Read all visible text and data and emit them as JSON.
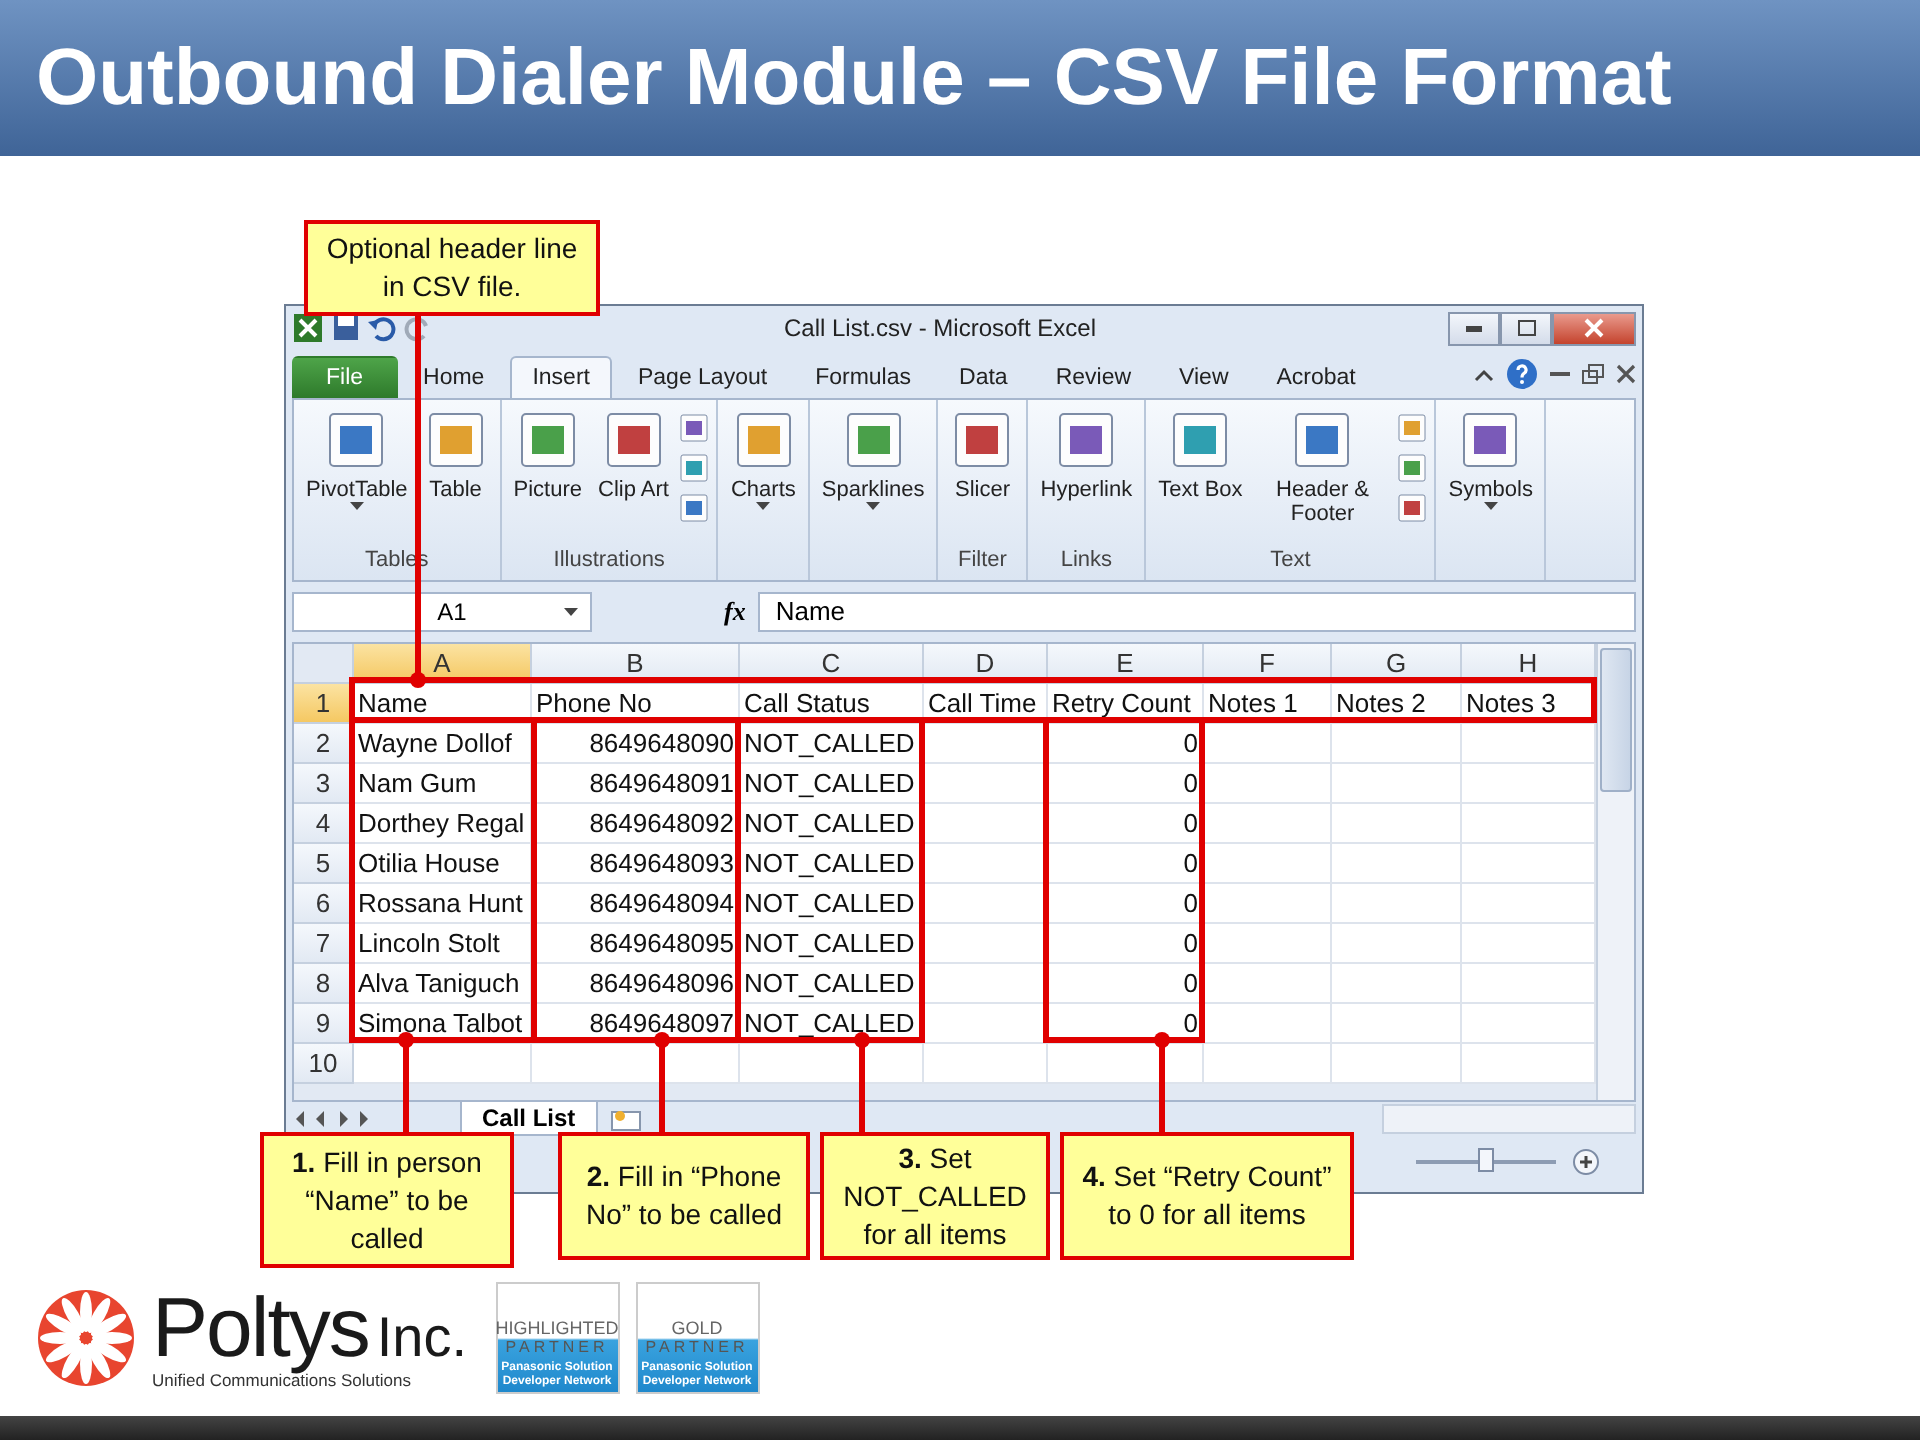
{
  "slide_title": "Outbound Dialer Module – CSV File Format",
  "excel": {
    "window_title": "Call List.csv  -  Microsoft Excel",
    "tabs": [
      {
        "label": "File",
        "kind": "file",
        "selected": false
      },
      {
        "label": "Home",
        "kind": "tab",
        "selected": false
      },
      {
        "label": "Insert",
        "kind": "tab",
        "selected": true
      },
      {
        "label": "Page Layout",
        "kind": "tab",
        "selected": false
      },
      {
        "label": "Formulas",
        "kind": "tab",
        "selected": false
      },
      {
        "label": "Data",
        "kind": "tab",
        "selected": false
      },
      {
        "label": "Review",
        "kind": "tab",
        "selected": false
      },
      {
        "label": "View",
        "kind": "tab",
        "selected": false
      },
      {
        "label": "Acrobat",
        "kind": "tab",
        "selected": false
      }
    ],
    "ribbon_groups": [
      {
        "label": "Tables",
        "kind": "plain",
        "buttons": [
          {
            "label": "PivotTable",
            "dropdown": true
          },
          {
            "label": "Table",
            "dropdown": false
          }
        ]
      },
      {
        "label": "Illustrations",
        "kind": "stacked",
        "buttons": [
          {
            "label": "Picture",
            "dropdown": false
          },
          {
            "label": "Clip Art",
            "dropdown": false
          }
        ]
      },
      {
        "kind": "plain",
        "buttons": [
          {
            "label": "Charts",
            "dropdown": true
          }
        ]
      },
      {
        "kind": "plain",
        "buttons": [
          {
            "label": "Sparklines",
            "dropdown": true
          }
        ]
      },
      {
        "label": "Filter",
        "kind": "plain",
        "buttons": [
          {
            "label": "Slicer",
            "dropdown": false
          }
        ]
      },
      {
        "label": "Links",
        "kind": "plain",
        "buttons": [
          {
            "label": "Hyperlink",
            "dropdown": false
          }
        ]
      },
      {
        "label": "Text",
        "kind": "stacked",
        "buttons": [
          {
            "label": "Text Box",
            "dropdown": false
          },
          {
            "label": "Header & Footer",
            "dropdown": false
          }
        ]
      },
      {
        "kind": "plain",
        "buttons": [
          {
            "label": "Symbols",
            "dropdown": true
          }
        ]
      }
    ],
    "name_box": "A1",
    "function_label": "fx",
    "formula": "Name",
    "columns": [
      {
        "letter": "A",
        "selected": true
      },
      {
        "letter": "B",
        "selected": false
      },
      {
        "letter": "C",
        "selected": false
      },
      {
        "letter": "D",
        "selected": false
      },
      {
        "letter": "E",
        "selected": false
      },
      {
        "letter": "F",
        "selected": false
      },
      {
        "letter": "G",
        "selected": false
      },
      {
        "letter": "H",
        "selected": false
      }
    ],
    "header_row": {
      "number": "1",
      "selected": true,
      "cells": [
        "Name",
        "Phone No",
        "Call Status",
        "Call Time",
        "Retry Count",
        "Notes 1",
        "Notes 2",
        "Notes 3"
      ]
    },
    "rows": [
      {
        "number": "2",
        "name": "Wayne Dollof",
        "phone_no": "8649648090",
        "call_status": "NOT_CALLED",
        "retry_count": "0"
      },
      {
        "number": "3",
        "name": "Nam Gum",
        "phone_no": "8649648091",
        "call_status": "NOT_CALLED",
        "retry_count": "0"
      },
      {
        "number": "4",
        "name": "Dorthey Regal",
        "phone_no": "8649648092",
        "call_status": "NOT_CALLED",
        "retry_count": "0"
      },
      {
        "number": "5",
        "name": "Otilia House",
        "phone_no": "8649648093",
        "call_status": "NOT_CALLED",
        "retry_count": "0"
      },
      {
        "number": "6",
        "name": "Rossana Hunt",
        "phone_no": "8649648094",
        "call_status": "NOT_CALLED",
        "retry_count": "0"
      },
      {
        "number": "7",
        "name": "Lincoln Stolt",
        "phone_no": "8649648095",
        "call_status": "NOT_CALLED",
        "retry_count": "0"
      },
      {
        "number": "8",
        "name": "Alva Taniguch",
        "phone_no": "8649648096",
        "call_status": "NOT_CALLED",
        "retry_count": "0"
      },
      {
        "number": "9",
        "name": "Simona Talbot",
        "phone_no": "8649648097",
        "call_status": "NOT_CALLED",
        "retry_count": "0"
      },
      {
        "number": "10"
      }
    ],
    "sheet_tabs": [
      {
        "label": "Call List",
        "selected": true
      }
    ],
    "zoom": {
      "level": 0.5
    }
  },
  "callouts": [
    {
      "text": "Optional header line in CSV file."
    },
    {
      "text": "**1.** Fill in person “Name” to be called"
    },
    {
      "text": "**2.** Fill in “Phone No” to be called"
    },
    {
      "text": "**3.** Set NOT_CALLED for all items"
    },
    {
      "text": "**4.** Set “Retry Count” to 0 for all items"
    }
  ],
  "footer": {
    "company": "Poltys",
    "suffix": "Inc.",
    "tagline": "Unified Communications Solutions",
    "badges": [
      {
        "top": "HIGHLIGHTED",
        "middle": "PARTNER",
        "bottom": "Panasonic Solution Developer Network"
      },
      {
        "top": "GOLD",
        "middle": "PARTNER",
        "bottom": "Panasonic Solution Developer Network"
      }
    ]
  }
}
